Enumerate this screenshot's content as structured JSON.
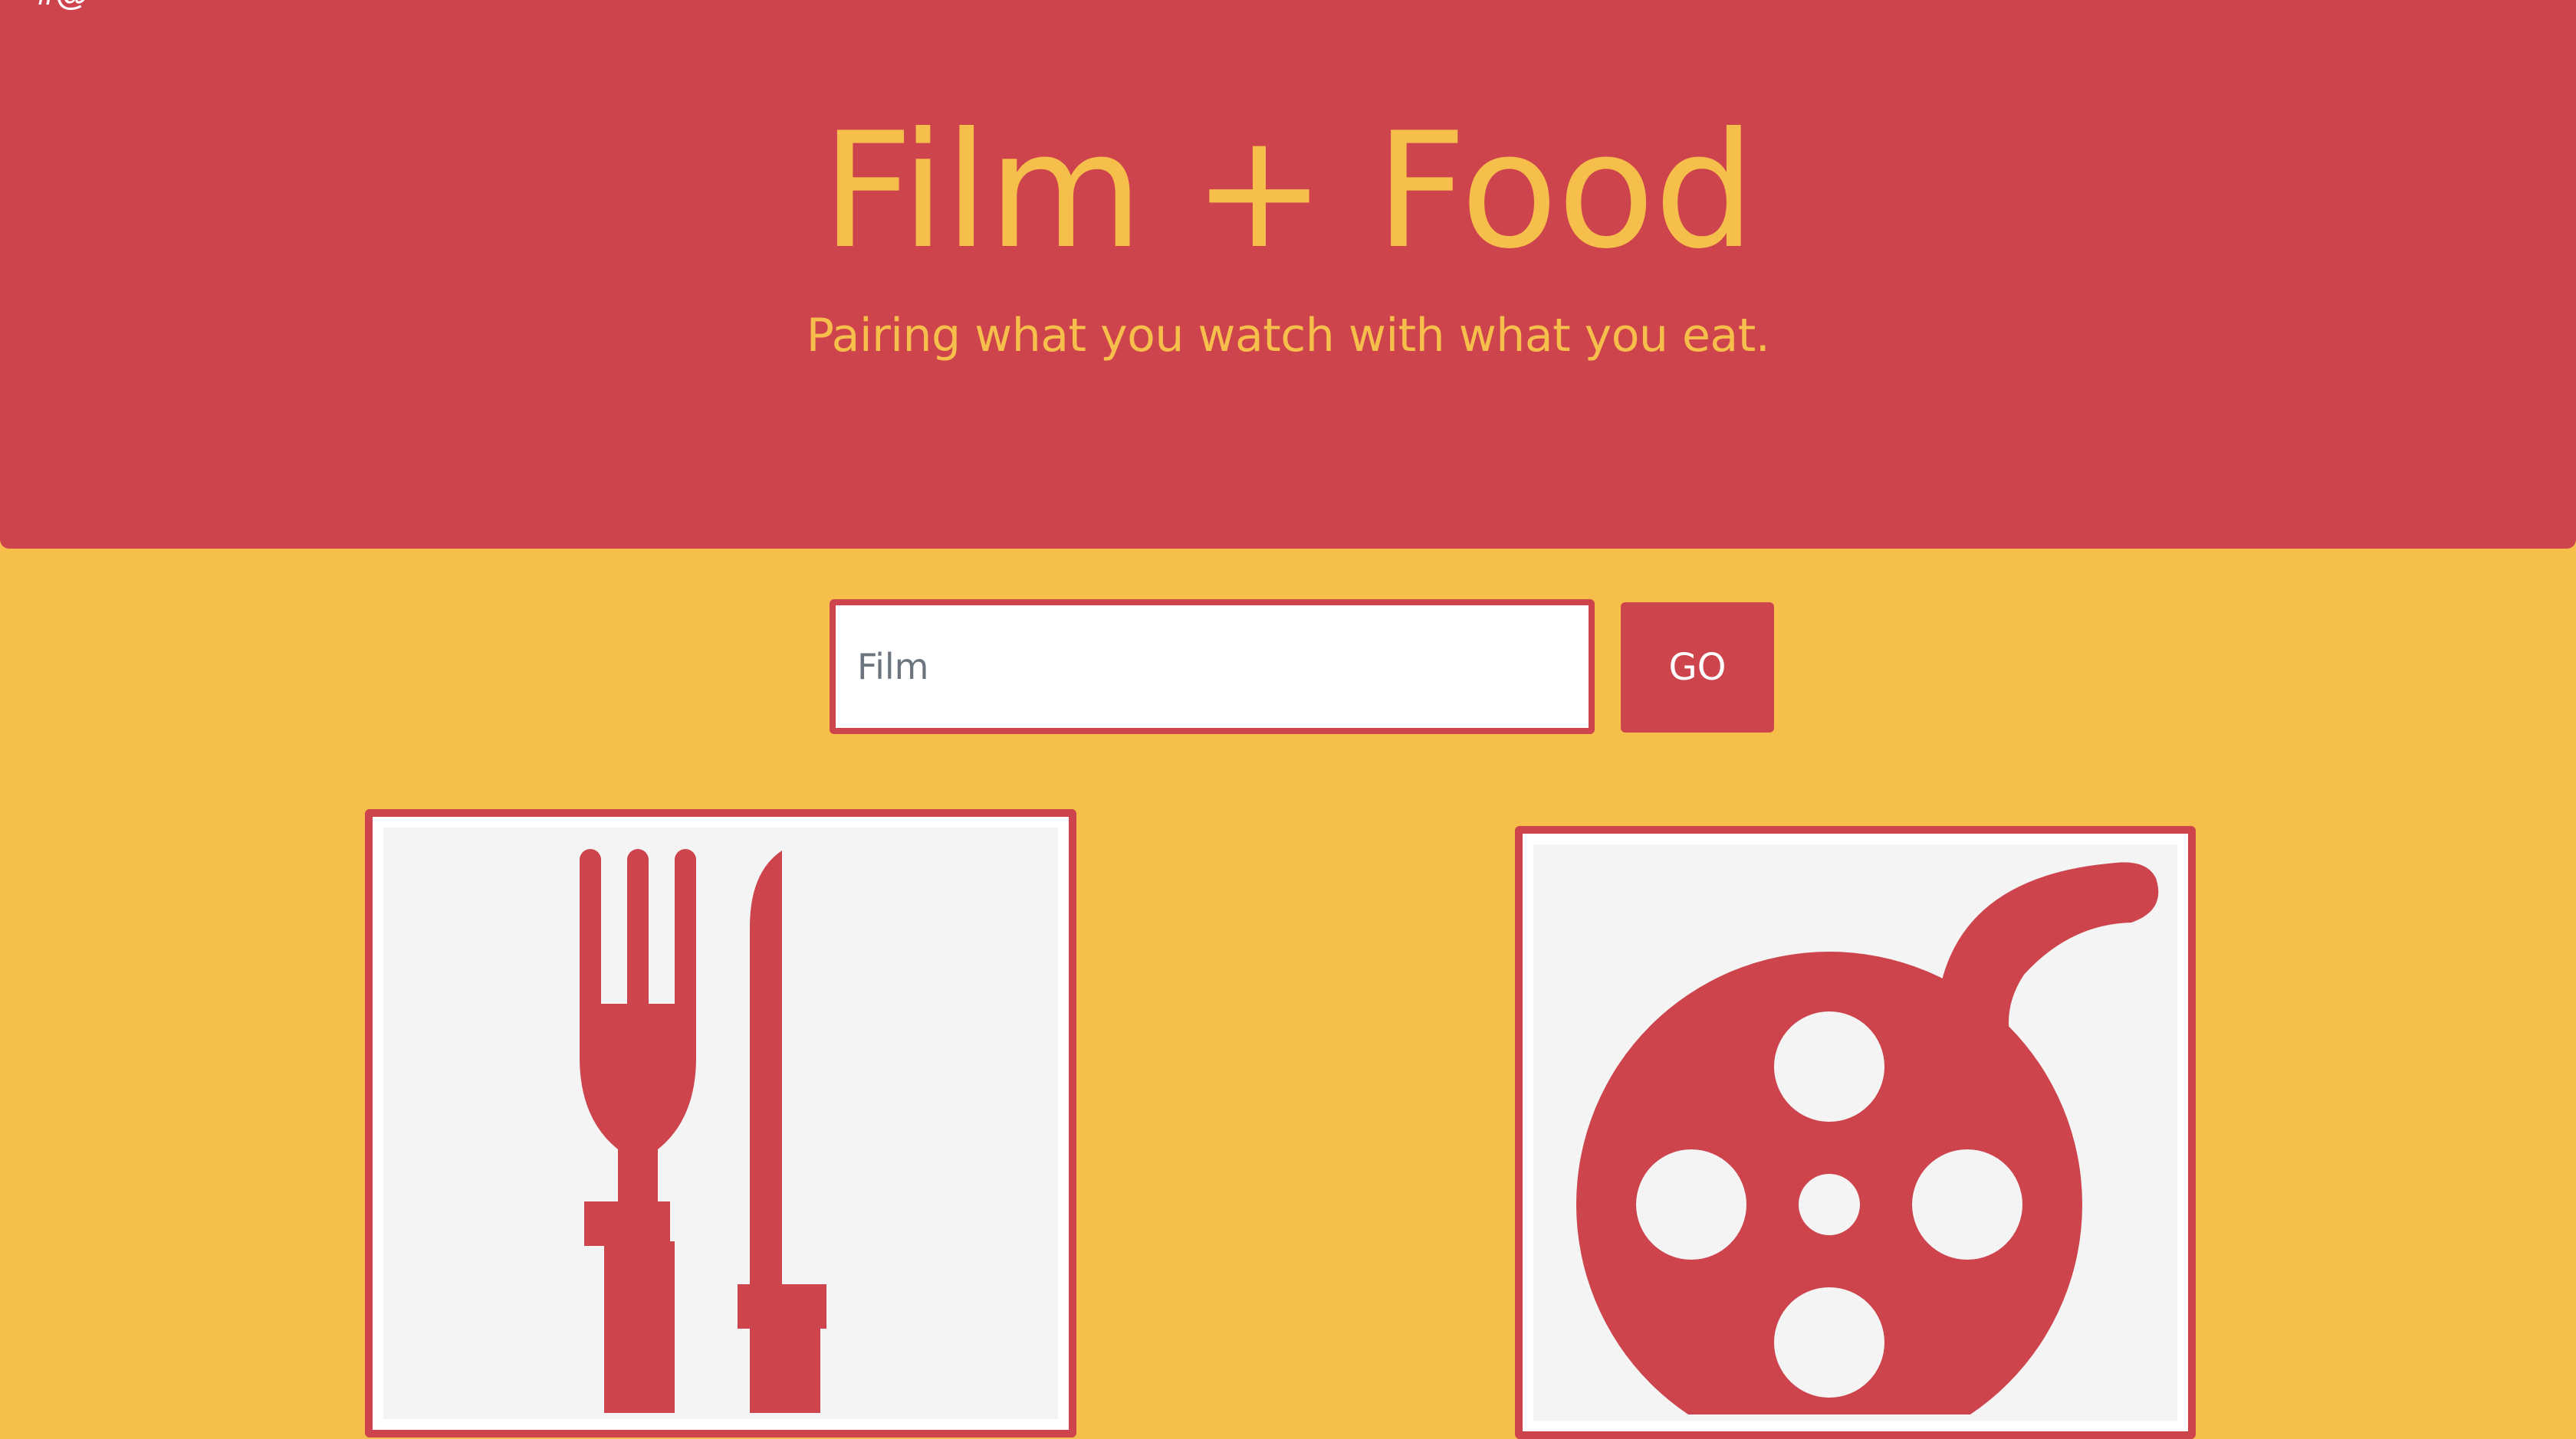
{
  "top_strip": {
    "partial_text": "#@"
  },
  "hero": {
    "title": "Film + Food",
    "subtitle": "Pairing what you watch with what you eat."
  },
  "search": {
    "placeholder": "Film",
    "value": "",
    "button_label": "GO"
  },
  "cards": [
    {
      "icon": "fork-knife-icon"
    },
    {
      "icon": "film-reel-icon"
    }
  ],
  "colors": {
    "accent_red": "#cd444c",
    "accent_yellow": "#f6bf4b",
    "card_bg": "#f4f4f4"
  }
}
